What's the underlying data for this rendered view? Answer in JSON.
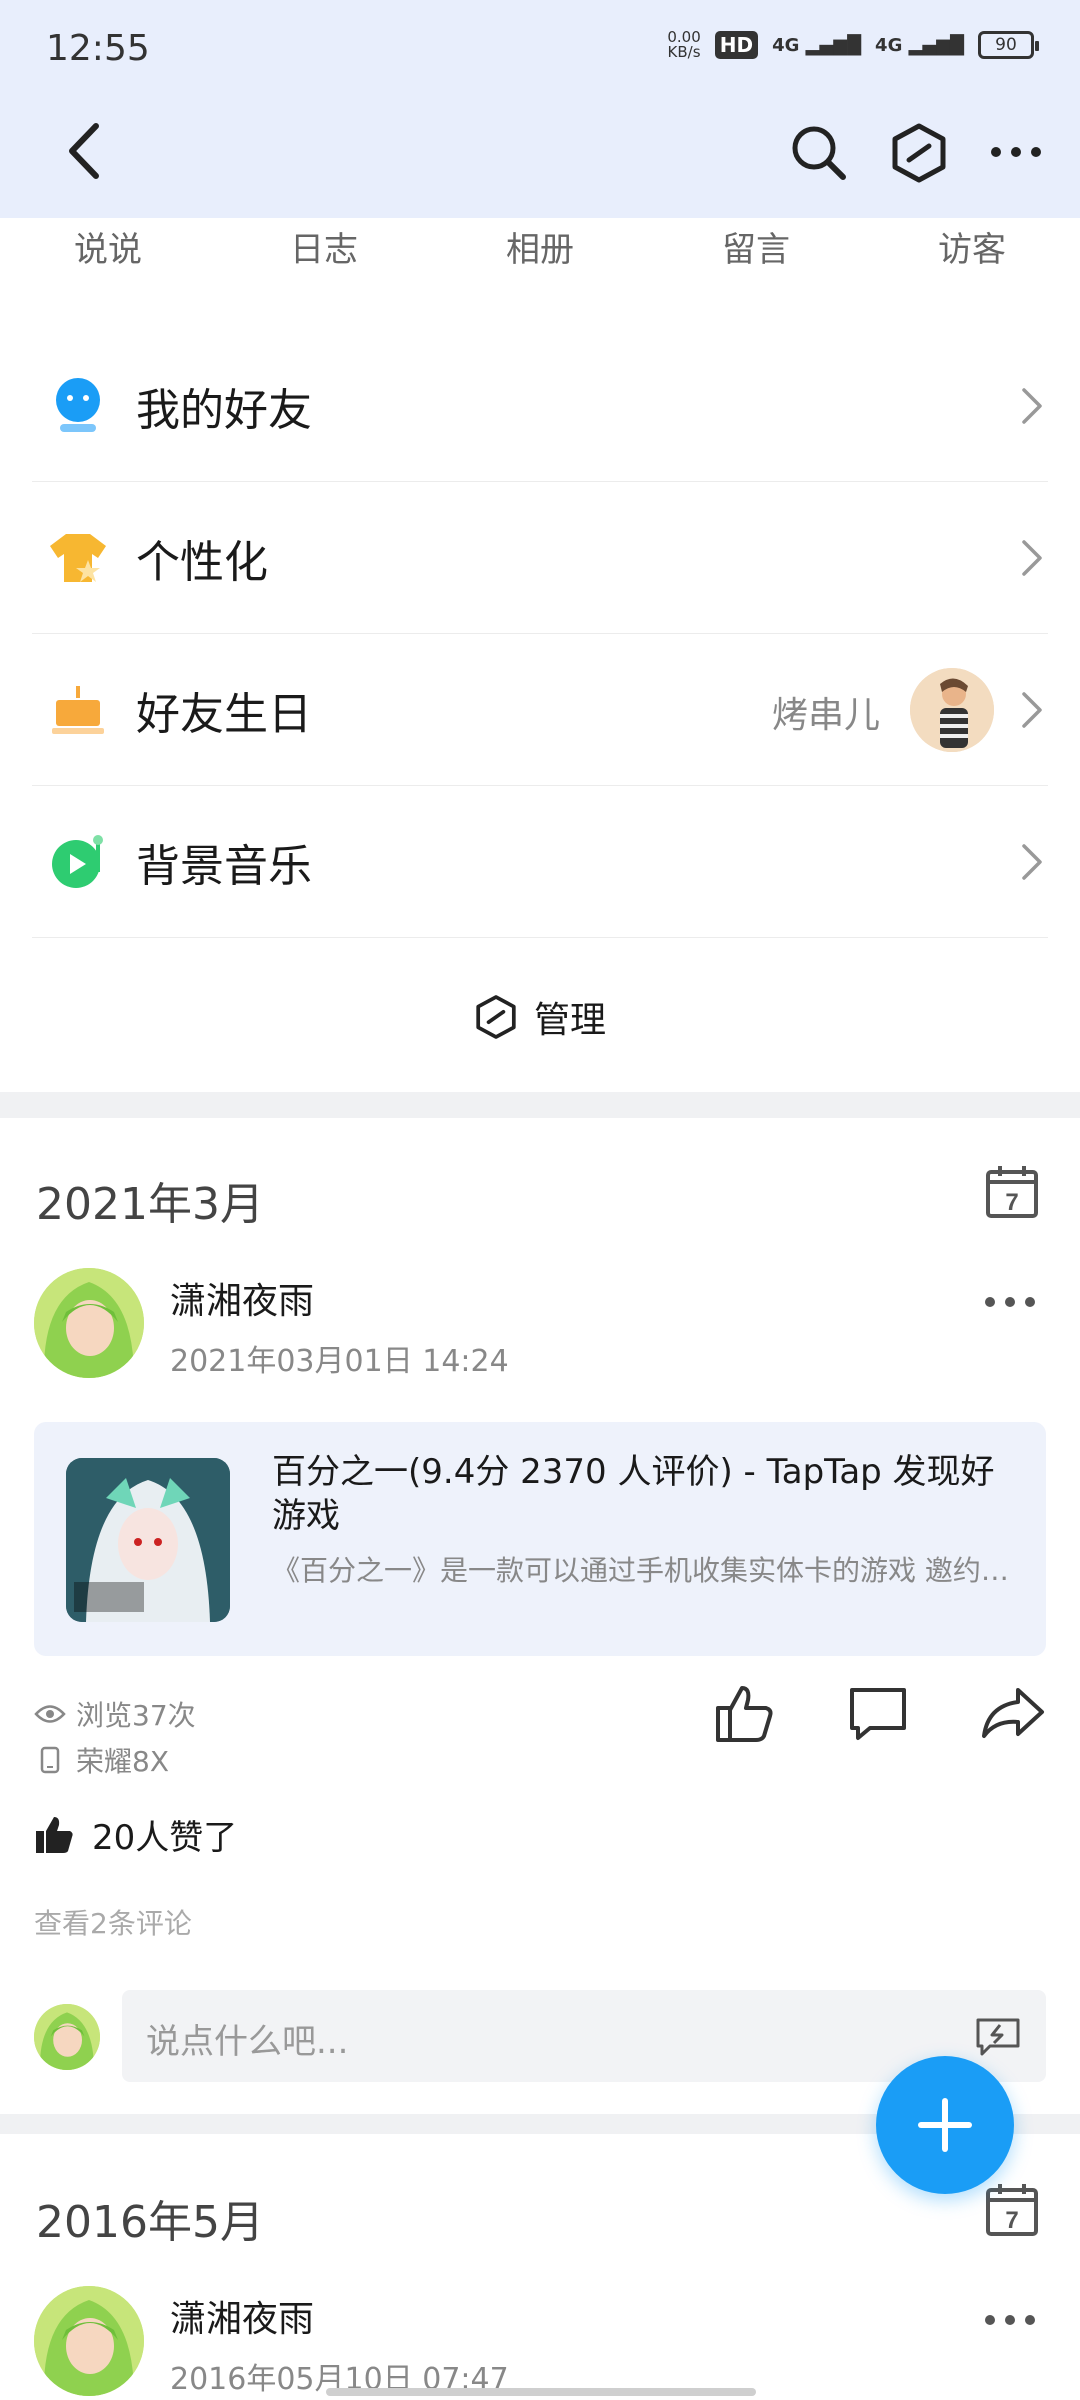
{
  "status_bar": {
    "time": "12:55",
    "speed_value": "0.00",
    "speed_unit": "KB/s",
    "hd": "HD",
    "sim1": "4G",
    "sim2": "4G",
    "battery": "90"
  },
  "stats": [
    "说说",
    "日志",
    "相册",
    "留言",
    "访客"
  ],
  "menu": {
    "friends": "我的好友",
    "personalize": "个性化",
    "birthday": "好友生日",
    "birthday_name": "烤串儿",
    "music": "背景音乐"
  },
  "manage_label": "管理",
  "feed": {
    "month1": "2021年3月",
    "post1": {
      "author": "潇湘夜雨",
      "time": "2021年03月01日 14:24",
      "share_title": "百分之一(9.4分 2370 人评价) - TapTap 发现好游戏",
      "share_desc": "《百分之一》是一款可以通过手机收集实体卡的游戏 邀约国内外一线绘画艺术家与知名画师每月进行一...",
      "views": "浏览37次",
      "device": "荣耀8X",
      "likes": "20人赞了",
      "view_comments": "查看2条评论",
      "comment_placeholder": "说点什么吧..."
    },
    "month2": "2016年5月",
    "post2": {
      "author": "潇湘夜雨",
      "time": "2016年05月10日 07:47"
    }
  },
  "calendar_day": "7",
  "colors": {
    "header_bg": "#e8eefc",
    "accent": "#1a9df6",
    "friends_icon": "#1a9df6",
    "personalize_icon": "#f7b731",
    "birthday_icon": "#f7a93b",
    "music_icon": "#2ecc71"
  }
}
